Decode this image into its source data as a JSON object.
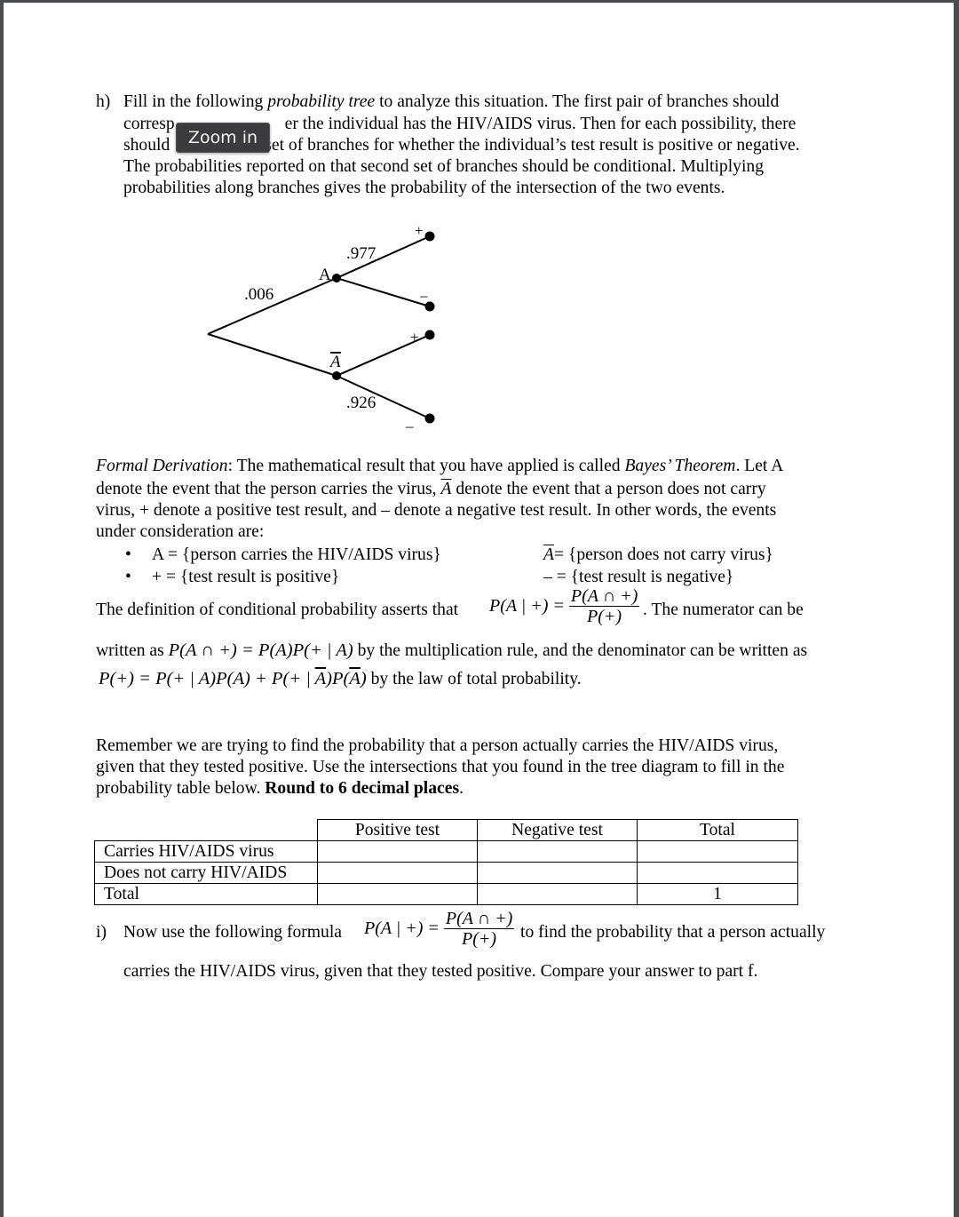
{
  "viewer": {
    "tooltip": "Zoom in"
  },
  "part_h": {
    "marker": "h)",
    "line1_pre": "Fill in the following ",
    "line1_italic": "probability tree",
    "line1_post": " to analyze this situation.  The first pair of branches should",
    "line2_a": "corresp",
    "line2_b": "er the individual has the HIV/AIDS virus.  Then for each possibility, there",
    "line3_a": "should",
    "line3_b": "set of branches for whether the individual’s test result is positive or negative.",
    "line4": "The probabilities reported on that second set of branches should be conditional.  Multiplying",
    "line5": "probabilities along branches gives the probability of the intersection of the two events."
  },
  "tree": {
    "first_branch_prob": ".006",
    "node_A_label": "A",
    "node_Abar_label": "A",
    "A_pos_prob": ".977",
    "Abar_neg_prob": ".926",
    "leaf_labels": [
      "+",
      "–",
      "+",
      "–"
    ]
  },
  "derivation": {
    "lead_italic": "Formal Derivation",
    "line1_mid": ": The mathematical result that you have applied is called ",
    "theorem_italic": "Bayes’ Theorem",
    "line1_post": ".  Let A",
    "line2_pre": "denote the event that the person carries the virus, ",
    "line2_abar": "A",
    "line2_post": " denote the event that a person does not carry",
    "line3": "virus, + denote a positive test result, and – denote a negative test result.  In other words, the events",
    "line4": "under consideration are:",
    "bullets": [
      {
        "left": "A = {person carries the HIV/AIDS virus}",
        "right_sym": "A",
        "right": "= {person does not carry virus}"
      },
      {
        "left": "+ = {test result is positive}",
        "right_sym": "–",
        "right": " = {test result is negative}"
      }
    ],
    "cond_def_pre": "The definition of conditional probability asserts that ",
    "cond_def_post": ".  The numerator can be",
    "mult_pre": "written as ",
    "mult_post": " by the multiplication rule, and the denominator can be written as",
    "total_post": " by the law of total probability."
  },
  "remember": {
    "line1": "Remember we are trying to find the probability that a person actually carries the HIV/AIDS virus,",
    "line2": "given that they tested positive.  Use the intersections that you found in the tree diagram to fill in the",
    "line3_pre": "probability table below. ",
    "line3_bold": "Round to 6 decimal places",
    "line3_post": "."
  },
  "prob_table": {
    "headers": [
      "",
      "Positive test",
      "Negative test",
      "Total"
    ],
    "rows": [
      {
        "label": "Carries HIV/AIDS virus",
        "cells": [
          "",
          "",
          ""
        ]
      },
      {
        "label": "Does not carry HIV/AIDS",
        "cells": [
          "",
          "",
          ""
        ]
      },
      {
        "label": "Total",
        "cells": [
          "",
          "",
          "1"
        ]
      }
    ]
  },
  "part_i": {
    "marker": "i)",
    "pre": "Now use the following formula ",
    "post": " to find the probability that a person actually",
    "line2": "carries the HIV/AIDS virus, given that they tested positive.  Compare your answer to part f."
  }
}
